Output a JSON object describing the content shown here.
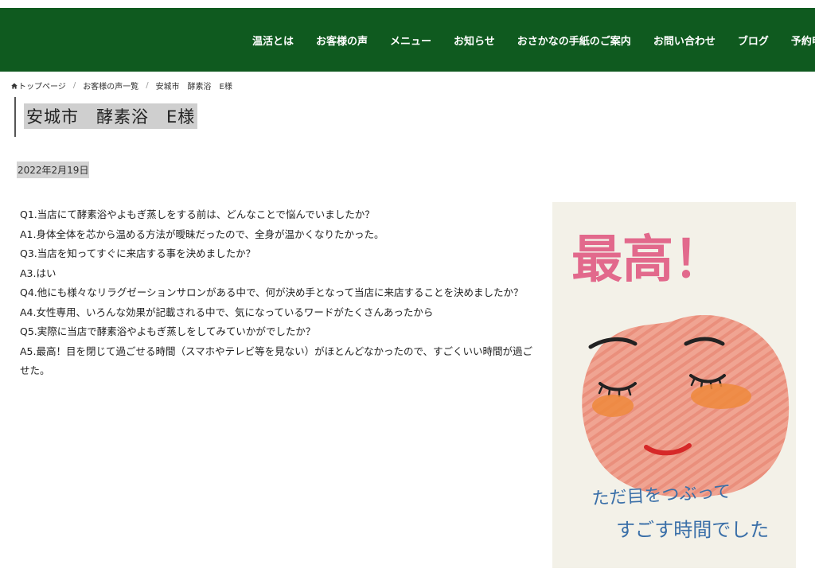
{
  "nav": {
    "items": [
      "温活とは",
      "お客様の声",
      "メニュー",
      "お知らせ",
      "おさかなの手紙のご案内",
      "お問い合わせ",
      "ブログ",
      "予約申込"
    ]
  },
  "breadcrumb": {
    "home": "トップページ",
    "list": "お客様の声一覧",
    "current": "安城市　酵素浴　E様",
    "separator": "/"
  },
  "page": {
    "title": "安城市　酵素浴　E様",
    "date": "2022年2月19日"
  },
  "qa": [
    "Q1.当店にて酵素浴やよもぎ蒸しをする前は、どんなことで悩んでいましたか？",
    "A1.身体全体を芯から温める方法が曖昧だったので、全身が温かくなりたかった。",
    "Q3.当店を知ってすぐに来店する事を決めましたか？",
    "A3.はい",
    "Q4.他にも様々なリラグゼーションサロンがある中で、何が決め手となって当店に来店することを決めましたか？",
    "A4.女性専用、いろんな効果が記載される中で、気になっているワードがたくさんあったから",
    "Q5.実際に当店で酵素浴やよもぎ蒸しをしてみていかがでしたか？",
    "A5.最高！目を閉じて過ごせる時間（スマホやテレビ等を見ない）がほとんどなかったので、すごくいい時間が過ごせた。"
  ],
  "card": {
    "headline": "最高！",
    "line1": "ただ目をつぶって",
    "line2": "すごす時間でした"
  },
  "colors": {
    "header_bg": "#0f5a1f",
    "face": "#f0a492",
    "cheek": "#ee8a3c",
    "headline": "#e2698c",
    "handwriting": "#3a6fa8"
  }
}
